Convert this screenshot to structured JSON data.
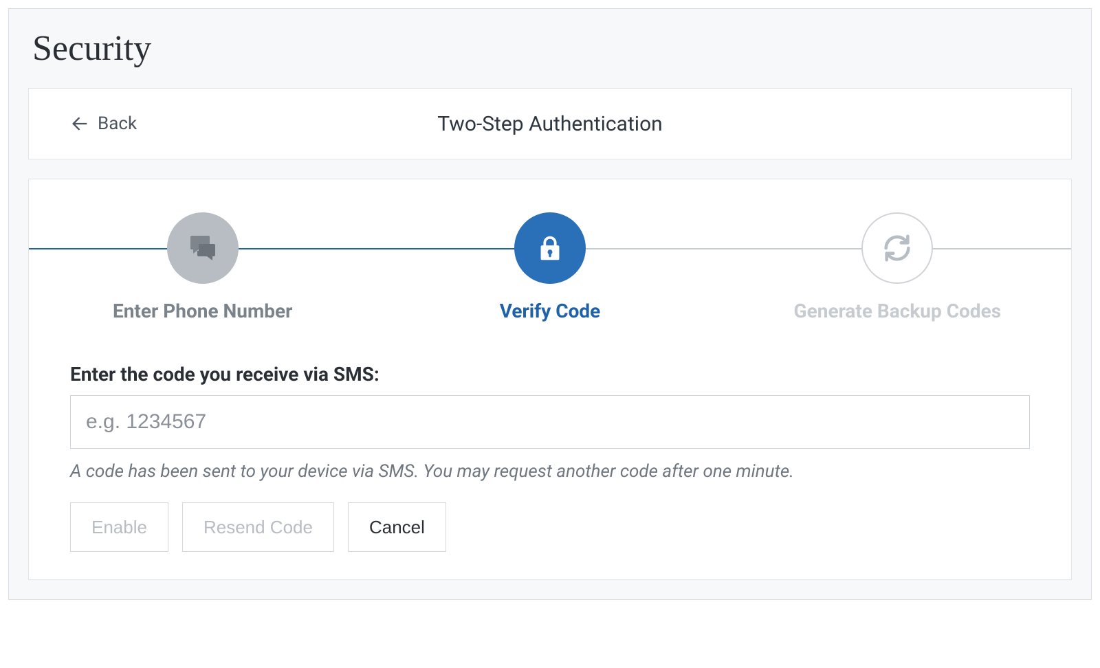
{
  "page": {
    "title": "Security"
  },
  "header": {
    "back_label": "Back",
    "title": "Two-Step Authentication"
  },
  "stepper": {
    "steps": [
      {
        "label": "Enter Phone Number",
        "state": "completed",
        "icon": "chat-icon"
      },
      {
        "label": "Verify Code",
        "state": "active",
        "icon": "lock-icon"
      },
      {
        "label": "Generate Backup Codes",
        "state": "pending",
        "icon": "sync-icon"
      }
    ]
  },
  "form": {
    "label": "Enter the code you receive via SMS:",
    "placeholder": "e.g. 1234567",
    "value": "",
    "hint": "A code has been sent to your device via SMS. You may request another code after one minute."
  },
  "buttons": {
    "enable": "Enable",
    "resend": "Resend Code",
    "cancel": "Cancel"
  }
}
